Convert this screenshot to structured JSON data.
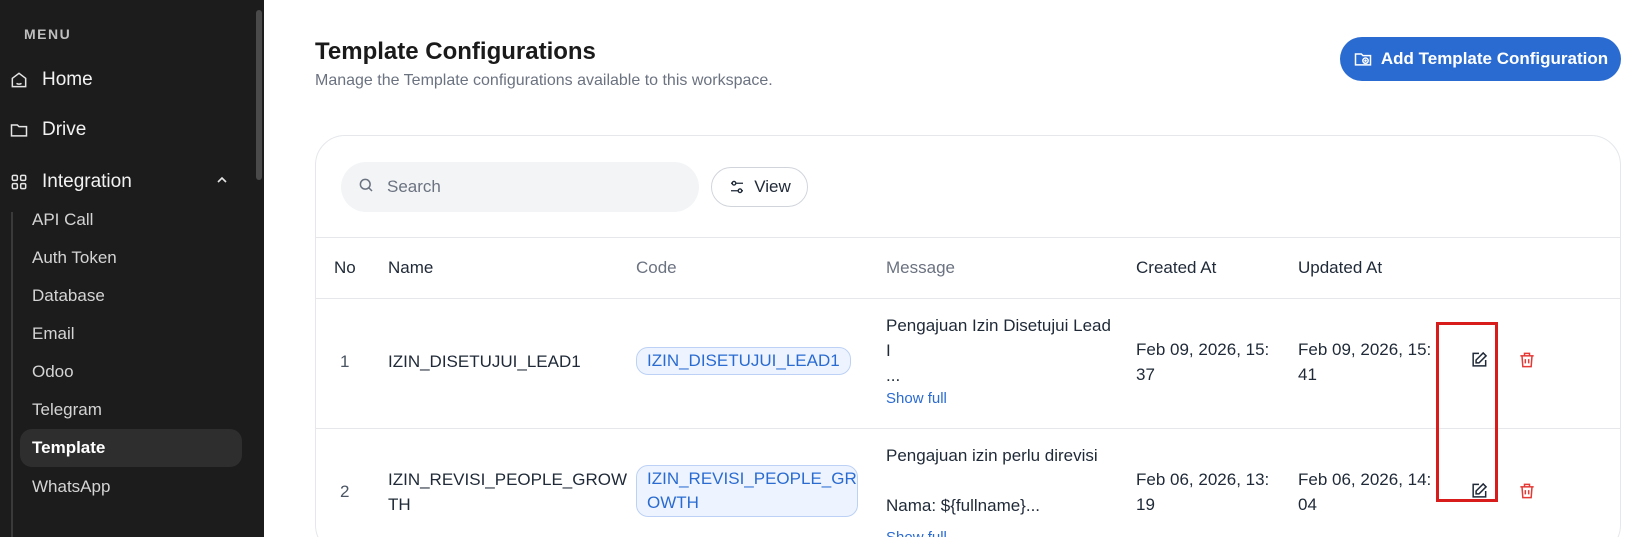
{
  "sidebar": {
    "heading": "MENU",
    "home": "Home",
    "drive": "Drive",
    "integration": "Integration",
    "sub_items": [
      "API Call",
      "Auth Token",
      "Database",
      "Email",
      "Odoo",
      "Telegram",
      "Template",
      "WhatsApp"
    ],
    "active_item": "Template"
  },
  "header": {
    "title": "Template Configurations",
    "subtitle": "Manage the Template configurations available to this workspace.",
    "add_button": "Add Template Configuration"
  },
  "toolbar": {
    "search_placeholder": "Search",
    "view_label": "View"
  },
  "table": {
    "columns": [
      "No",
      "Name",
      "Code",
      "Message",
      "Created At",
      "Updated At"
    ],
    "rows": [
      {
        "no": "1",
        "name": "IZIN_DISETUJUI_LEAD1",
        "code": "IZIN_DISETUJUI_LEAD1",
        "message_line1": "Pengajuan Izin Disetujui Lead",
        "message_line2": "I",
        "message_line3": "...",
        "show_full": "Show full",
        "created_line1": "Feb 09, 2026, 15:",
        "created_line2": "37",
        "updated_line1": "Feb 09, 2026, 15:",
        "updated_line2": "41"
      },
      {
        "no": "2",
        "name_line1": "IZIN_REVISI_PEOPLE_GROW",
        "name_line2": "TH",
        "code_line1": "IZIN_REVISI_PEOPLE_GR",
        "code_line2": "OWTH",
        "message_line1": "Pengajuan izin perlu direvisi",
        "message_line2": "Nama: ${fullname}...",
        "show_full": "Show full",
        "created_line1": "Feb 06, 2026, 13:",
        "created_line2": "19",
        "updated_line1": "Feb 06, 2026, 14:",
        "updated_line2": "04"
      }
    ]
  },
  "colors": {
    "sidebar_bg": "#1c1c1c",
    "accent": "#2a6bd1",
    "delete": "#e53935",
    "highlight": "#d81b1b"
  }
}
